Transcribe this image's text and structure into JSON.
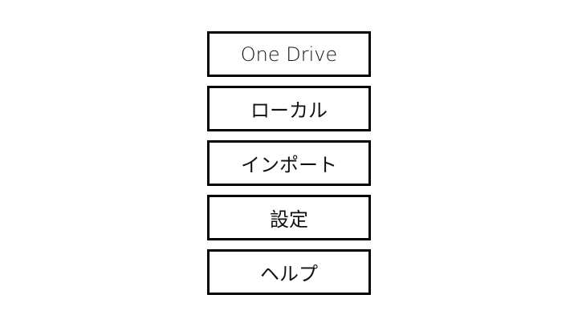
{
  "menu": {
    "items": [
      {
        "label": "One Drive"
      },
      {
        "label": "ローカル"
      },
      {
        "label": "インポート"
      },
      {
        "label": "設定"
      },
      {
        "label": "ヘルプ"
      }
    ]
  }
}
